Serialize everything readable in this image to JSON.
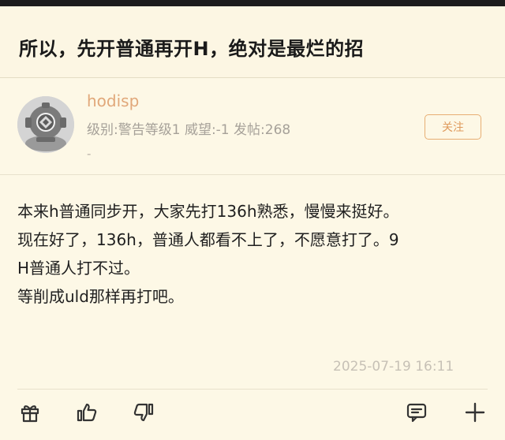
{
  "thread": {
    "title": "所以，先开普通再开H，绝对是最烂的招"
  },
  "author": {
    "username": "hodisp",
    "meta": "级别:警告等级1  威望:-1  发帖:268",
    "signature": "-",
    "follow_label": "关注"
  },
  "post": {
    "lines": [
      "本来h普通同步开，大家先打136h熟悉，慢慢来挺好。",
      "现在好了，136h，普通人都看不上了，不愿意打了。9",
      "H普通人打不过。",
      "等削成uld那样再打吧。"
    ],
    "timestamp": "2025-07-19 16:11"
  },
  "actions": {
    "icons": [
      "gift-icon",
      "thumbs-up-icon",
      "thumbs-down-icon",
      "comment-icon",
      "plus-icon"
    ]
  }
}
